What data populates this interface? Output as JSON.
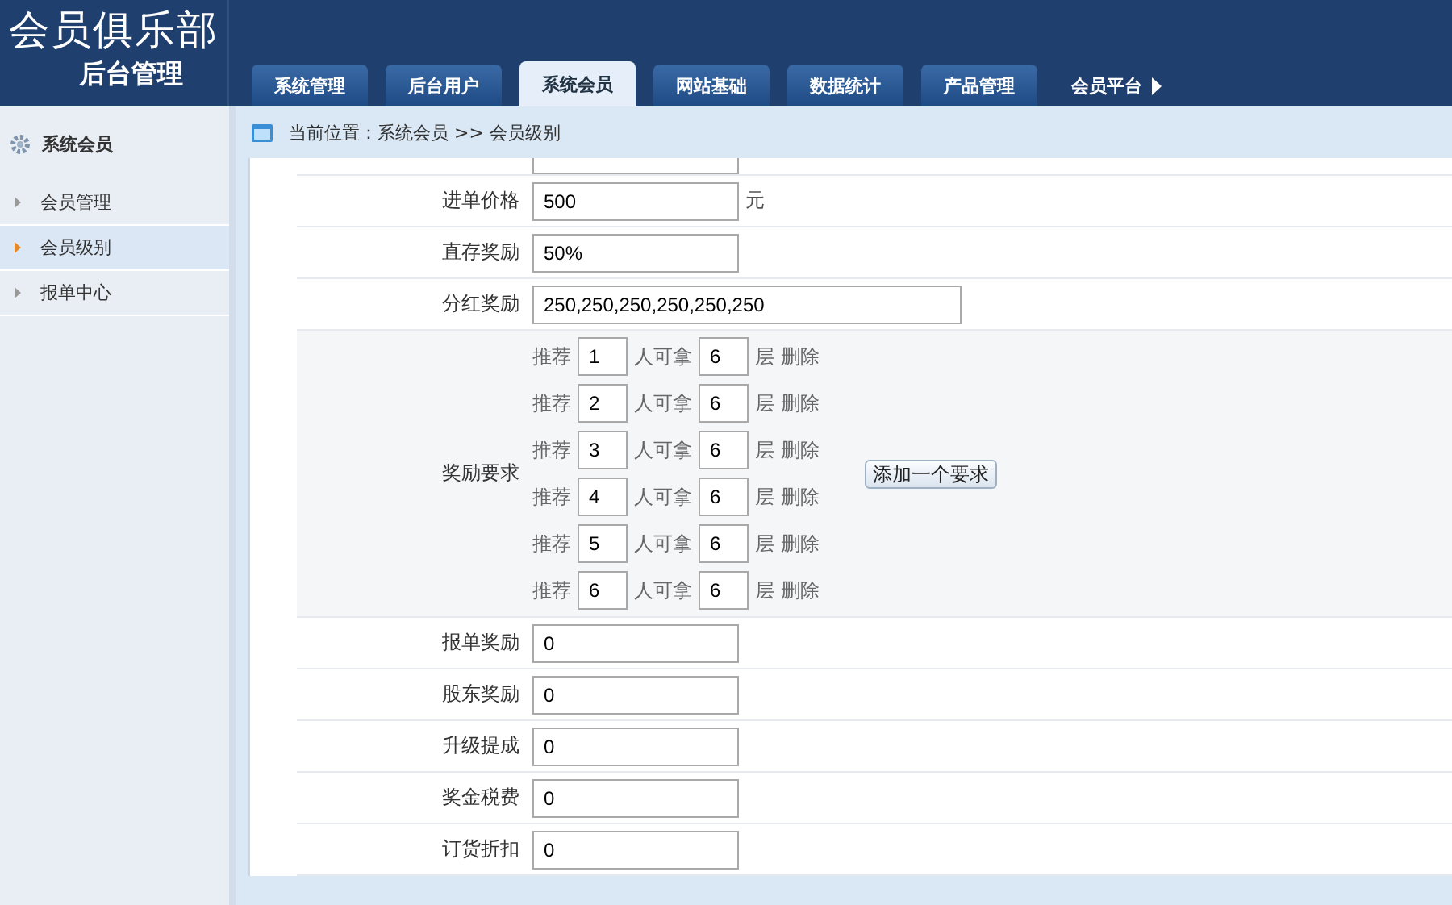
{
  "header": {
    "title": "会员俱乐部",
    "subtitle": "后台管理",
    "tabs": [
      {
        "label": "系统管理",
        "selected": false,
        "kind": "tab"
      },
      {
        "label": "后台用户",
        "selected": false,
        "kind": "tab"
      },
      {
        "label": "系统会员",
        "selected": true,
        "kind": "tab"
      },
      {
        "label": "网站基础",
        "selected": false,
        "kind": "tab"
      },
      {
        "label": "数据统计",
        "selected": false,
        "kind": "tab"
      },
      {
        "label": "产品管理",
        "selected": false,
        "kind": "tab"
      },
      {
        "label": "会员平台",
        "selected": false,
        "kind": "more"
      }
    ]
  },
  "sidebar": {
    "heading": "系统会员",
    "items": [
      {
        "label": "会员管理",
        "selected": false
      },
      {
        "label": "会员级别",
        "selected": true
      },
      {
        "label": "报单中心",
        "selected": false
      }
    ]
  },
  "breadcrumb": "当前位置：系统会员 >> 会员级别",
  "form": {
    "rows": [
      {
        "kind": "field",
        "label": "进单价格",
        "value": "500",
        "unit": "元"
      },
      {
        "kind": "field",
        "label": "直存奖励",
        "value": "50%"
      },
      {
        "kind": "long",
        "label": "分红奖励",
        "value": "250,250,250,250,250,250"
      },
      {
        "kind": "rules",
        "label": "奖励要求",
        "add_button": "添加一个要求",
        "rules": [
          {
            "prefix": "推荐",
            "count": "1",
            "middle": "人可拿",
            "layers": "6",
            "suffix": "层",
            "action": "删除"
          },
          {
            "prefix": "推荐",
            "count": "2",
            "middle": "人可拿",
            "layers": "6",
            "suffix": "层",
            "action": "删除"
          },
          {
            "prefix": "推荐",
            "count": "3",
            "middle": "人可拿",
            "layers": "6",
            "suffix": "层",
            "action": "删除"
          },
          {
            "prefix": "推荐",
            "count": "4",
            "middle": "人可拿",
            "layers": "6",
            "suffix": "层",
            "action": "删除"
          },
          {
            "prefix": "推荐",
            "count": "5",
            "middle": "人可拿",
            "layers": "6",
            "suffix": "层",
            "action": "删除"
          },
          {
            "prefix": "推荐",
            "count": "6",
            "middle": "人可拿",
            "layers": "6",
            "suffix": "层",
            "action": "删除"
          }
        ]
      },
      {
        "kind": "field",
        "label": "报单奖励",
        "value": "0"
      },
      {
        "kind": "field",
        "label": "股东奖励",
        "value": "0"
      },
      {
        "kind": "field",
        "label": "升级提成",
        "value": "0"
      },
      {
        "kind": "field",
        "label": "奖金税费",
        "value": "0"
      },
      {
        "kind": "field",
        "label": "订货折扣",
        "value": "0"
      }
    ]
  }
}
